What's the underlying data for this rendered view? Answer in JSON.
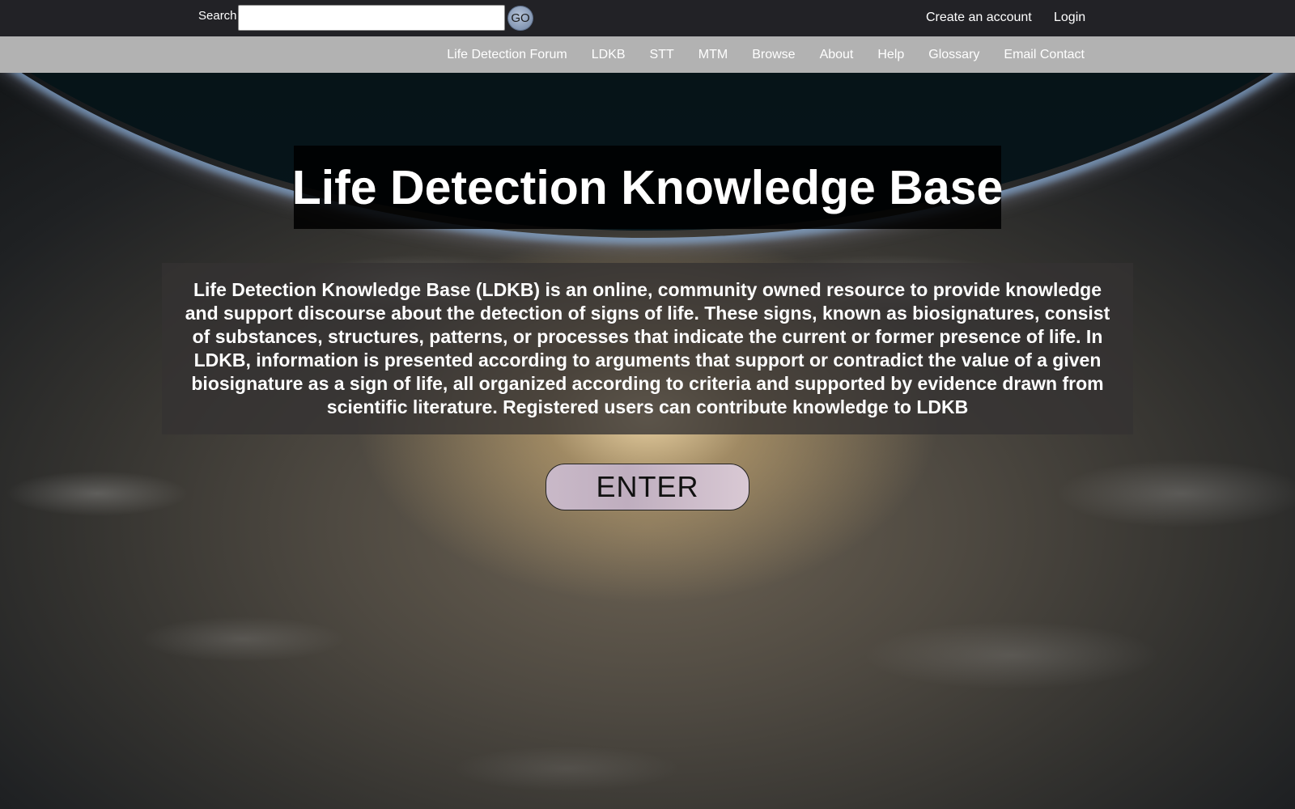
{
  "header": {
    "search_label": "Search",
    "search_value": "",
    "go_label": "GO",
    "create_account_label": "Create an account",
    "login_label": "Login"
  },
  "nav": {
    "items": [
      {
        "label": "Life Detection Forum"
      },
      {
        "label": "LDKB"
      },
      {
        "label": "STT"
      },
      {
        "label": "MTM"
      },
      {
        "label": "Browse"
      },
      {
        "label": "About"
      },
      {
        "label": "Help"
      },
      {
        "label": "Glossary"
      },
      {
        "label": "Email Contact"
      }
    ]
  },
  "hero": {
    "title": "Life Detection Knowledge Base",
    "description": "Life Detection Knowledge Base (LDKB) is an online, community owned resource to provide knowledge and support discourse about the detection of signs of life. These signs, known as biosignatures, consist of substances, structures, patterns, or processes that indicate the current or former presence of life. In LDKB, information is presented according to arguments that support or contradict the value of a given biosignature as a sign of life, all organized according to criteria and supported by evidence drawn from scientific literature. Registered users can contribute knowledge to LDKB",
    "enter_label": "ENTER"
  },
  "colors": {
    "topbar": "#222226",
    "navbar": "#b2b2b2",
    "go_button": "#8ea0bb",
    "enter_button": "#c9b9c8"
  }
}
